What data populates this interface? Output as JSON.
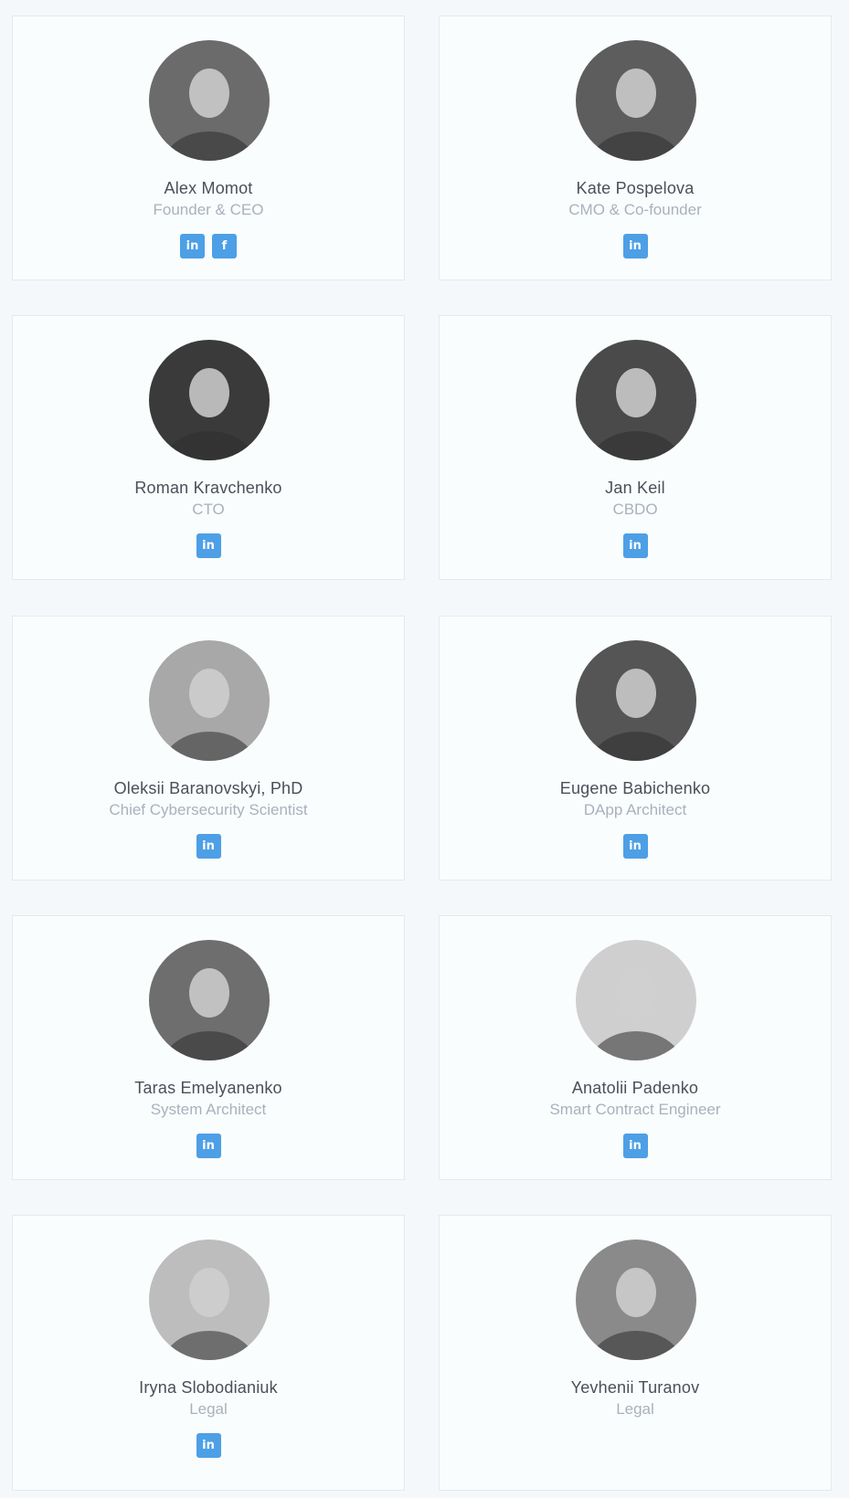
{
  "team": [
    {
      "name": "Alex Momot",
      "role": "Founder & CEO",
      "socials": [
        "linkedin-icon",
        "facebook-icon"
      ],
      "avatar_tone": "#6b6b6b"
    },
    {
      "name": "Kate Pospelova",
      "role": "CMO & Co-founder",
      "socials": [
        "linkedin-icon"
      ],
      "avatar_tone": "#5d5d5d"
    },
    {
      "name": "Roman Kravchenko",
      "role": "CTO",
      "socials": [
        "linkedin-icon"
      ],
      "avatar_tone": "#3a3a3a"
    },
    {
      "name": "Jan Keil",
      "role": "CBDO",
      "socials": [
        "linkedin-icon"
      ],
      "avatar_tone": "#4a4a4a"
    },
    {
      "name": "Oleksii Baranovskyi, PhD",
      "role": "Chief Cybersecurity Scientist",
      "socials": [
        "linkedin-icon"
      ],
      "avatar_tone": "#a8a8a8"
    },
    {
      "name": "Eugene Babichenko",
      "role": "DApp Architect",
      "socials": [
        "linkedin-icon"
      ],
      "avatar_tone": "#555555"
    },
    {
      "name": "Taras Emelyanenko",
      "role": "System Architect",
      "socials": [
        "linkedin-icon"
      ],
      "avatar_tone": "#6e6e6e"
    },
    {
      "name": "Anatolii Padenko",
      "role": "Smart Contract Engineer",
      "socials": [
        "linkedin-icon"
      ],
      "avatar_tone": "#cfcfcf"
    },
    {
      "name": "Iryna Slobodianiuk",
      "role": "Legal",
      "socials": [
        "linkedin-icon"
      ],
      "avatar_tone": "#bdbdbd"
    },
    {
      "name": "Yevhenii Turanov",
      "role": "Legal",
      "socials": [],
      "avatar_tone": "#8a8a8a"
    }
  ],
  "social_glyphs": {
    "linkedin-icon": "in",
    "facebook-icon": "f"
  },
  "colors": {
    "social_bg": "#4d9fe6",
    "name": "#4a4f5a",
    "role": "#a9b1bd"
  }
}
